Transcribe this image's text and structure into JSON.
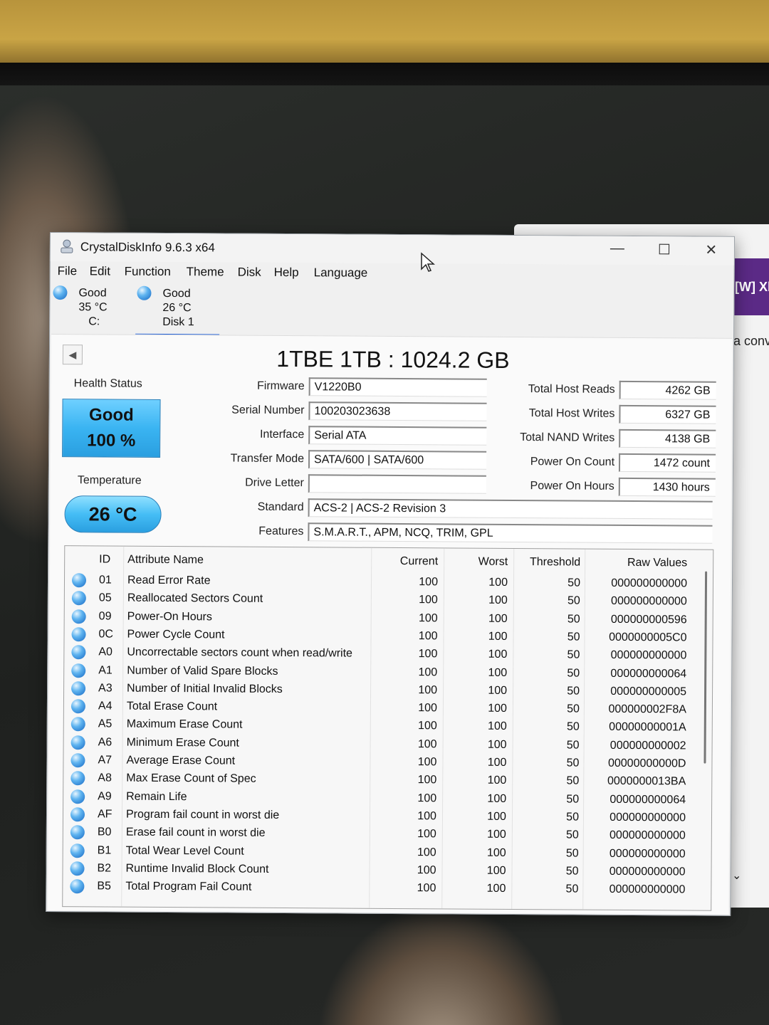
{
  "window": {
    "title": "CrystalDiskInfo 9.6.3 x64"
  },
  "menu": [
    "File",
    "Edit",
    "Function",
    "Theme",
    "Disk",
    "Help",
    "Language"
  ],
  "disk_tabs": [
    {
      "status": "Good",
      "temp": "35 °C",
      "name": "C:"
    },
    {
      "status": "Good",
      "temp": "26 °C",
      "name": "Disk 1"
    }
  ],
  "model_line": "1TBE 1TB : 1024.2 GB",
  "health": {
    "label": "Health Status",
    "status": "Good",
    "percent": "100 %"
  },
  "temperature": {
    "label": "Temperature",
    "value": "26 °C"
  },
  "fields": {
    "firmware": {
      "label": "Firmware",
      "value": "V1220B0"
    },
    "serial": {
      "label": "Serial Number",
      "value": "100203023638"
    },
    "interface": {
      "label": "Interface",
      "value": "Serial ATA"
    },
    "transfer": {
      "label": "Transfer Mode",
      "value": "SATA/600 | SATA/600"
    },
    "drive_letter": {
      "label": "Drive Letter",
      "value": ""
    },
    "standard": {
      "label": "Standard",
      "value": "ACS-2 | ACS-2 Revision 3"
    },
    "features": {
      "label": "Features",
      "value": "S.M.A.R.T., APM, NCQ, TRIM, GPL"
    }
  },
  "stats": {
    "host_reads": {
      "label": "Total Host Reads",
      "value": "4262 GB"
    },
    "host_writes": {
      "label": "Total Host Writes",
      "value": "6327 GB"
    },
    "nand_writes": {
      "label": "Total NAND Writes",
      "value": "4138 GB"
    },
    "power_count": {
      "label": "Power On Count",
      "value": "1472 count"
    },
    "power_hours": {
      "label": "Power On Hours",
      "value": "1430 hours"
    }
  },
  "table": {
    "headers": {
      "id": "ID",
      "name": "Attribute Name",
      "current": "Current",
      "worst": "Worst",
      "threshold": "Threshold",
      "raw": "Raw Values"
    },
    "rows": [
      [
        "01",
        "Read Error Rate",
        "100",
        "100",
        "50",
        "000000000000"
      ],
      [
        "05",
        "Reallocated Sectors Count",
        "100",
        "100",
        "50",
        "000000000000"
      ],
      [
        "09",
        "Power-On Hours",
        "100",
        "100",
        "50",
        "000000000596"
      ],
      [
        "0C",
        "Power Cycle Count",
        "100",
        "100",
        "50",
        "0000000005C0"
      ],
      [
        "A0",
        "Uncorrectable sectors count when read/write",
        "100",
        "100",
        "50",
        "000000000000"
      ],
      [
        "A1",
        "Number of Valid Spare Blocks",
        "100",
        "100",
        "50",
        "000000000064"
      ],
      [
        "A3",
        "Number of Initial Invalid Blocks",
        "100",
        "100",
        "50",
        "000000000005"
      ],
      [
        "A4",
        "Total Erase Count",
        "100",
        "100",
        "50",
        "000000002F8A"
      ],
      [
        "A5",
        "Maximum Erase Count",
        "100",
        "100",
        "50",
        "00000000001A"
      ],
      [
        "A6",
        "Minimum Erase Count",
        "100",
        "100",
        "50",
        "000000000002"
      ],
      [
        "A7",
        "Average Erase Count",
        "100",
        "100",
        "50",
        "00000000000D"
      ],
      [
        "A8",
        "Max Erase Count of Spec",
        "100",
        "100",
        "50",
        "0000000013BA"
      ],
      [
        "A9",
        "Remain Life",
        "100",
        "100",
        "50",
        "000000000064"
      ],
      [
        "AF",
        "Program fail count in worst die",
        "100",
        "100",
        "50",
        "000000000000"
      ],
      [
        "B0",
        "Erase fail count in worst die",
        "100",
        "100",
        "50",
        "000000000000"
      ],
      [
        "B1",
        "Total Wear Level Count",
        "100",
        "100",
        "50",
        "000000000000"
      ],
      [
        "B2",
        "Runtime Invalid Block Count",
        "100",
        "100",
        "50",
        "000000000000"
      ],
      [
        "B5",
        "Total Program Fail Count",
        "100",
        "100",
        "50",
        "000000000000"
      ]
    ]
  },
  "background_window": {
    "banner_text": "[W] Xb",
    "snippet_text": "a conv"
  }
}
